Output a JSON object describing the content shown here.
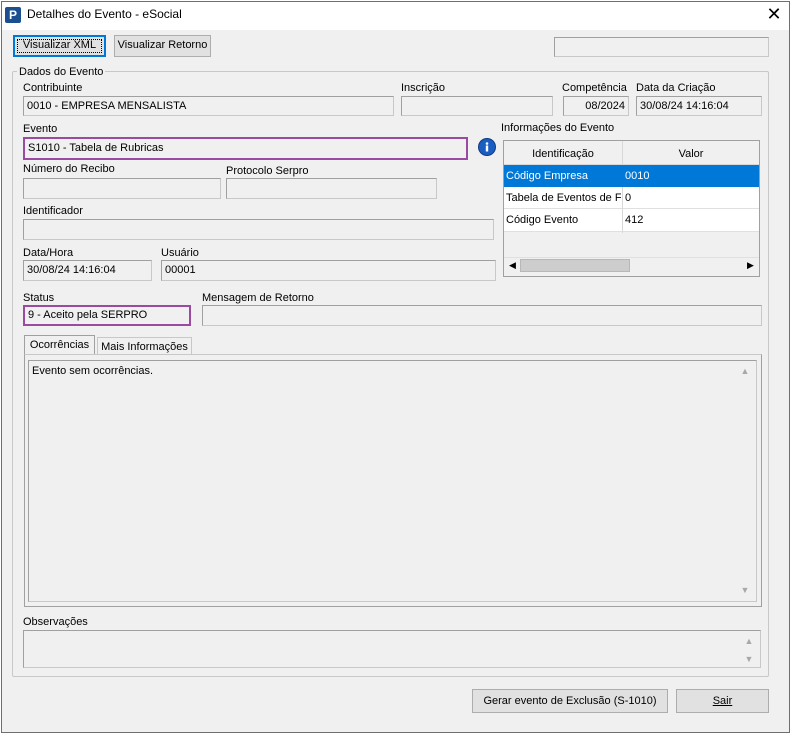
{
  "window": {
    "title": "Detalhes do Evento - eSocial",
    "app_icon": "P",
    "close_glyph": "✕"
  },
  "toolbar": {
    "view_xml": "Visualizar XML",
    "view_return": "Visualizar Retorno",
    "status_text": ""
  },
  "group": {
    "title": "Dados do Evento"
  },
  "fields": {
    "contribuinte": {
      "label": "Contribuinte",
      "value": "0010 - EMPRESA MENSALISTA"
    },
    "inscricao": {
      "label": "Inscrição",
      "value": ""
    },
    "competencia": {
      "label": "Competência",
      "value": "08/2024"
    },
    "data_criacao": {
      "label": "Data da Criação",
      "value": "30/08/24 14:16:04"
    },
    "evento": {
      "label": "Evento",
      "value": "S1010 - Tabela de Rubricas"
    },
    "numero_recibo": {
      "label": "Número do Recibo",
      "value": ""
    },
    "protocolo": {
      "label": "Protocolo Serpro",
      "value": ""
    },
    "identificador": {
      "label": "Identificador",
      "value": ""
    },
    "data_hora": {
      "label": "Data/Hora",
      "value": "30/08/24 14:16:04"
    },
    "usuario": {
      "label": "Usuário",
      "value": "00001"
    },
    "status": {
      "label": "Status",
      "value": "9 - Aceito pela SERPRO"
    },
    "mensagem": {
      "label": "Mensagem de Retorno",
      "value": ""
    },
    "observacoes": {
      "label": "Observações",
      "value": ""
    }
  },
  "info": {
    "title": "Informações do Evento",
    "columns": [
      "Identificação",
      "Valor"
    ],
    "rows": [
      {
        "id": "Código Empresa",
        "value": "0010"
      },
      {
        "id": "Tabela de Eventos de F",
        "value": "0"
      },
      {
        "id": "Código Evento",
        "value": "412"
      }
    ],
    "scroll_left": "◀",
    "scroll_right": "▶"
  },
  "tabs": [
    {
      "label": "Ocorrências"
    },
    {
      "label": "Mais Informações"
    }
  ],
  "ocorrencias_text": "Evento sem ocorrências.",
  "scroll_up": "▲",
  "scroll_down": "▼",
  "footer": {
    "gerar_exclusao": "Gerar evento de Exclusão (S-1010)",
    "sair": "Sair"
  },
  "colors": {
    "highlight": "#9b4aa2",
    "selection": "#0078d7",
    "info_icon": "#1b5ec2"
  }
}
